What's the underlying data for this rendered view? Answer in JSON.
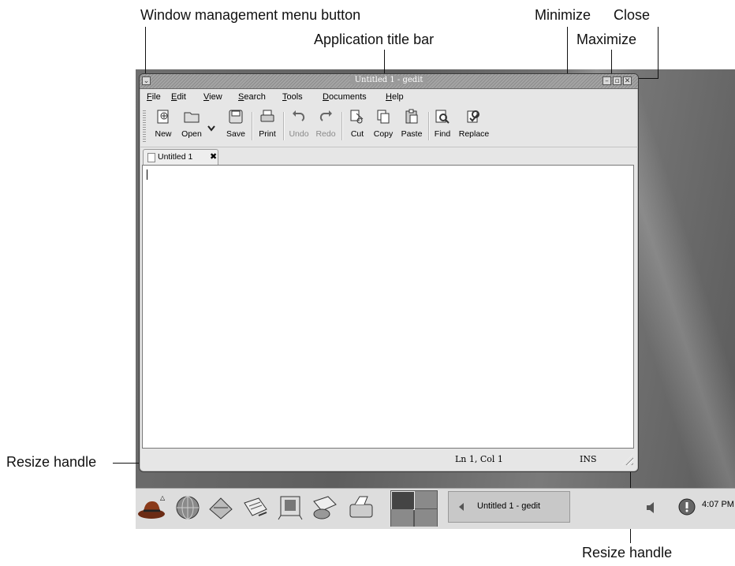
{
  "annotations": {
    "window_menu": "Window management menu button",
    "title_bar": "Application title bar",
    "minimize": "Minimize",
    "maximize": "Maximize",
    "close": "Close",
    "resize_left": "Resize handle",
    "resize_bottom": "Resize handle"
  },
  "window": {
    "title": "Untitled 1 - gedit",
    "menu_button_glyph": "⌄",
    "minimize_glyph": "–",
    "maximize_glyph": "▫",
    "close_glyph": "✕"
  },
  "menubar": {
    "items": [
      {
        "first": "F",
        "rest": "ile"
      },
      {
        "first": "E",
        "rest": "dit"
      },
      {
        "first": "V",
        "rest": "iew"
      },
      {
        "first": "S",
        "rest": "earch"
      },
      {
        "first": "T",
        "rest": "ools"
      },
      {
        "first": "D",
        "rest": "ocuments"
      },
      {
        "first": "H",
        "rest": "elp"
      }
    ]
  },
  "toolbar": {
    "new": "New",
    "open": "Open",
    "save": "Save",
    "print": "Print",
    "undo": "Undo",
    "redo": "Redo",
    "cut": "Cut",
    "copy": "Copy",
    "paste": "Paste",
    "find": "Find",
    "replace": "Replace"
  },
  "tab": {
    "label": "Untitled 1",
    "close_glyph": "✖"
  },
  "statusbar": {
    "position": "Ln 1, Col 1",
    "mode": "INS"
  },
  "panel": {
    "task_label": "Untitled 1 - gedit",
    "clock": "4:07 PM"
  },
  "colors": {
    "desktop": "#6a6a6a",
    "titlebar": "#9a9a9a",
    "window_bg": "#e6e6e6",
    "panel_bg": "#dddddd"
  }
}
